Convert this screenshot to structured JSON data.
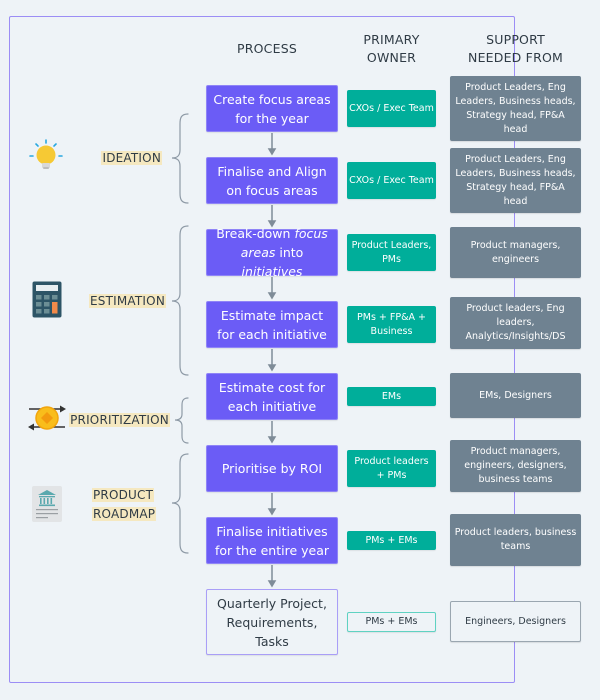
{
  "columns": {
    "process": "PROCESS",
    "owner_line1": "PRIMARY",
    "owner_line2": "OWNER",
    "support_line1": "SUPPORT",
    "support_line2": "NEEDED FROM"
  },
  "stages": [
    {
      "name": "ideation",
      "label_lines": [
        "IDEATION"
      ],
      "icon": "lightbulb-icon"
    },
    {
      "name": "estimation",
      "label_lines": [
        "ESTIMATION"
      ],
      "icon": "calculator-icon"
    },
    {
      "name": "prioritization",
      "label_lines": [
        "PRIORITIZATION"
      ],
      "icon": "exchange-coin-icon"
    },
    {
      "name": "product-roadmap",
      "label_lines": [
        "PRODUCT",
        "ROADMAP"
      ],
      "icon": "bank-document-icon"
    }
  ],
  "steps": [
    {
      "process_parts": [
        {
          "text": "Create focus areas for the year",
          "italic": false
        }
      ],
      "owner": "CXOs / Exec Team",
      "support": "Product Leaders, Eng Leaders, Business  heads, Strategy head, FP&A head"
    },
    {
      "process_parts": [
        {
          "text": "Finalise and Align on focus areas",
          "italic": false
        }
      ],
      "owner": "CXOs / Exec Team",
      "support": "Product Leaders, Eng Leaders, Business  heads, Strategy head, FP&A head"
    },
    {
      "process_parts": [
        {
          "text": "Break-down ",
          "italic": false
        },
        {
          "text": "focus areas",
          "italic": true
        },
        {
          "text": " into ",
          "italic": false
        },
        {
          "text": "initiatives",
          "italic": true
        }
      ],
      "owner": "Product Leaders, PMs",
      "support": "Product managers, engineers"
    },
    {
      "process_parts": [
        {
          "text": "Estimate impact for each initiative",
          "italic": false
        }
      ],
      "owner": "PMs + FP&A + Business",
      "support": "Product leaders, Eng leaders, Analytics/Insights/DS"
    },
    {
      "process_parts": [
        {
          "text": "Estimate cost for each initiative",
          "italic": false
        }
      ],
      "owner": "EMs",
      "support": "EMs, Designers"
    },
    {
      "process_parts": [
        {
          "text": "Prioritise by ROI",
          "italic": false
        }
      ],
      "owner": "Product leaders + PMs",
      "support": "Product managers, engineers, designers, business teams"
    },
    {
      "process_parts": [
        {
          "text": "Finalise initiatives for the entire year",
          "italic": false
        }
      ],
      "owner": "PMs + EMs",
      "support": "Product leaders, business teams"
    },
    {
      "process_parts": [
        {
          "text": "Quarterly Project, Requirements, Tasks",
          "italic": false
        }
      ],
      "owner": "PMs + EMs",
      "support": "Engineers, Designers"
    }
  ],
  "colors": {
    "process_fill": "#6b5cf6",
    "owner_fill": "#00ae9a",
    "support_fill": "#6f8291",
    "label_highlight": "#f5e8c0",
    "frame_border": "#9b8df5"
  }
}
